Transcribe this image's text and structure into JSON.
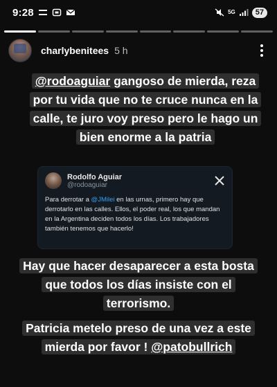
{
  "status_bar": {
    "time": "9:28",
    "network": "5G",
    "battery": "57"
  },
  "story": {
    "segments_total": 8,
    "segments_viewed": 1
  },
  "header": {
    "username": "charlybenitees",
    "time_ago": "5 h"
  },
  "caption1": {
    "mention": "@rodoaguiar",
    "text": " gangoso de mierda, reza por tu vida que no te cruce nunca en la calle, te juro voy preso pero le hago un bien enorme a la patria"
  },
  "tweet": {
    "name": "Rodolfo Aguiar",
    "handle": "@rodoaguiar",
    "text_before": "Para derrotar a ",
    "mention": "@JMilei",
    "text_after": " en las urnas, primero hay que derrotarlo en las calles. Ellos, el poder real, los que mandan en la Argentina deciden todos los días. Los trabajadores también tenemos que hacerlo!"
  },
  "caption2": {
    "text": "Hay que hacer desaparecer a esta bosta que todos los días insiste con el terrorismo."
  },
  "caption3": {
    "text": "Patricia metelo preso de una vez a este mierda por favor !",
    "mention": "@patobullrich"
  },
  "colors": {
    "background": "#0d0d0d",
    "caption_highlight": "#2f2f2f",
    "tweet_background": "#141a22",
    "tweet_mention": "#3a9ff0"
  },
  "icons": [
    "menu-icon",
    "screenshot-icon",
    "mail-icon",
    "mute-icon",
    "signal-icon",
    "more-icon",
    "x-logo-icon"
  ]
}
